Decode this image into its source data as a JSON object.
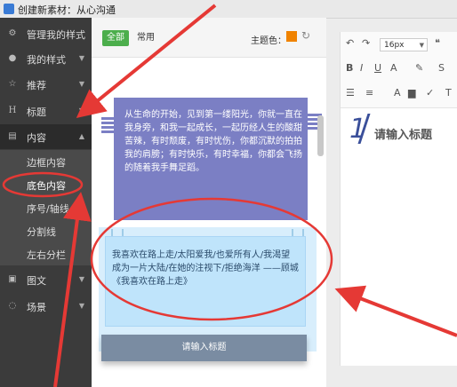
{
  "window": {
    "title": "创建新素材：从心沟通"
  },
  "sidebar": {
    "items": [
      {
        "label": "管理我的样式",
        "icon": "gears-icon"
      },
      {
        "label": "我的样式",
        "icon": "user-icon"
      },
      {
        "label": "推荐",
        "icon": "star-icon"
      },
      {
        "label": "标题",
        "icon": "heading-icon"
      },
      {
        "label": "内容",
        "icon": "document-icon"
      }
    ],
    "sub_items": [
      {
        "label": "边框内容"
      },
      {
        "label": "底色内容"
      },
      {
        "label": "序号/轴线"
      },
      {
        "label": "分割线"
      },
      {
        "label": "左右分栏"
      }
    ],
    "bottom_items": [
      {
        "label": "图文",
        "icon": "image-icon"
      },
      {
        "label": "场景",
        "icon": "chat-icon"
      }
    ]
  },
  "middle": {
    "tab_all": "全部",
    "tab_common": "常用",
    "theme_label": "主题色：",
    "theme_color": "#f08300",
    "card1_text": "从生命的开始，见到第一缕阳光，你就一直在我身旁，和我一起成长，一起历经人生的酸甜苦辣，有时颓废，有时忧伤，你都沉默的拍拍我的肩膀；有时快乐，有时幸福，你都会飞扬的随着我手舞足蹈。",
    "card2_text": "我喜欢在路上走/太阳爱我/也爱所有人/我渴望成为一片大陆/在她的注视下/拒绝海洋 ——顾城 《我喜欢在路上走》",
    "card3_text": "请输入标题"
  },
  "editor": {
    "font_size": "16px",
    "heading_number": "1",
    "heading_text": "请输入标题"
  }
}
